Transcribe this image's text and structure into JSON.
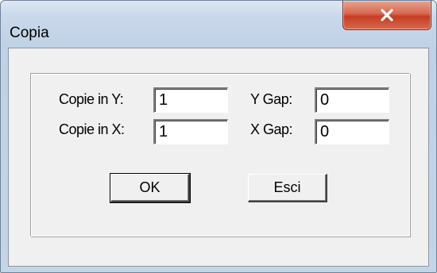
{
  "window": {
    "title": "Copia"
  },
  "fields": {
    "copie_y": {
      "label": "Copie in Y:",
      "value": "1"
    },
    "copie_x": {
      "label": "Copie in X:",
      "value": "1"
    },
    "y_gap": {
      "label": "Y Gap:",
      "value": "0"
    },
    "x_gap": {
      "label": "X Gap:",
      "value": "0"
    }
  },
  "buttons": {
    "ok": "OK",
    "esci": "Esci"
  },
  "icons": {
    "close": "close-icon"
  },
  "colors": {
    "close_button": "#c43d22",
    "dialog_face": "#f0f0f0",
    "window_frame": "#c9d9ea"
  }
}
